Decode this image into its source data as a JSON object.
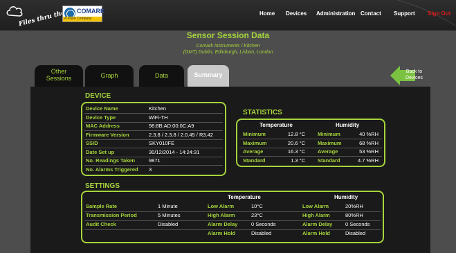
{
  "header": {
    "brand_text": "Files thru the air",
    "logo_name": "COMARK",
    "logo_sub": "A Fluke Company",
    "nav": {
      "home": "Home",
      "devices": "Devices",
      "administration": "Administration",
      "contact": "Contact",
      "support": "Support",
      "signout": "Sign Out"
    }
  },
  "page": {
    "title": "Sensor Session Data",
    "subtitle_line1": "Comark Instruments / Kitchen",
    "subtitle_line2": "(GMT) Dublin, Edinburgh, Lisbon, London"
  },
  "tabs": {
    "other_line1": "Other",
    "other_line2": "Sessions",
    "graph": "Graph",
    "data": "Data",
    "summary": "Summary"
  },
  "back": {
    "line1": "Back to",
    "line2": "Devices"
  },
  "device": {
    "title": "DEVICE",
    "rows": [
      {
        "label": "Device Name",
        "value": "Kitchen"
      },
      {
        "label": "Device Type",
        "value": "WiFi-TH"
      },
      {
        "label": "MAC Address",
        "value": "98:8B:AD:00:0C:A9"
      },
      {
        "label": "Firmware Version",
        "value": "2.3.8 / 2.3.8 / 2.0.45 / R3.42"
      },
      {
        "label": "SSID",
        "value": "SKY010FE"
      },
      {
        "label": "Date Set up",
        "value": "30/12/2014 - 14:24:31"
      },
      {
        "label": "No. Readings Taken",
        "value": "9871"
      },
      {
        "label": "No. Alarms Triggered",
        "value": "3"
      }
    ]
  },
  "statistics": {
    "title": "STATISTICS",
    "temp_header": "Temperature",
    "hum_header": "Humidity",
    "rows": [
      {
        "tlabel": "Minimum",
        "tvalue": "12.8 °C",
        "hlabel": "Minimum",
        "hvalue": "40 %RH"
      },
      {
        "tlabel": "Maximum",
        "tvalue": "20.6 °C",
        "hlabel": "Maximum",
        "hvalue": "68 %RH"
      },
      {
        "tlabel": "Average",
        "tvalue": "16.3 °C",
        "hlabel": "Average",
        "hvalue": "53 %RH"
      },
      {
        "tlabel": "Standard",
        "tvalue": "1.3 °C",
        "hlabel": "Standard",
        "hvalue": "4.7 %RH"
      }
    ]
  },
  "settings": {
    "title": "SETTINGS",
    "temp_header": "Temperature",
    "hum_header": "Humidity",
    "general": [
      {
        "label": "Sample Rate",
        "value": "1 Minute"
      },
      {
        "label": "Transmission Period",
        "value": "5 Minutes"
      },
      {
        "label": "Audit Check",
        "value": "Disabled"
      }
    ],
    "temperature": [
      {
        "label": "Low Alarm",
        "value": "10°C"
      },
      {
        "label": "High Alarm",
        "value": "23°C"
      },
      {
        "label": "Alarm Delay",
        "value": "0 Seconds"
      },
      {
        "label": "Alarm Hold",
        "value": "Disabled"
      }
    ],
    "humidity": [
      {
        "label": "Low Alarm",
        "value": "20%RH"
      },
      {
        "label": "High Alarm",
        "value": "80%RH"
      },
      {
        "label": "Alarm Delay",
        "value": "0 Seconds"
      },
      {
        "label": "Alarm Hold",
        "value": "Disabled"
      }
    ]
  },
  "colors": {
    "accent": "#a6d43c",
    "signout": "#e01a1a",
    "back_arrow": "#7cc242"
  }
}
